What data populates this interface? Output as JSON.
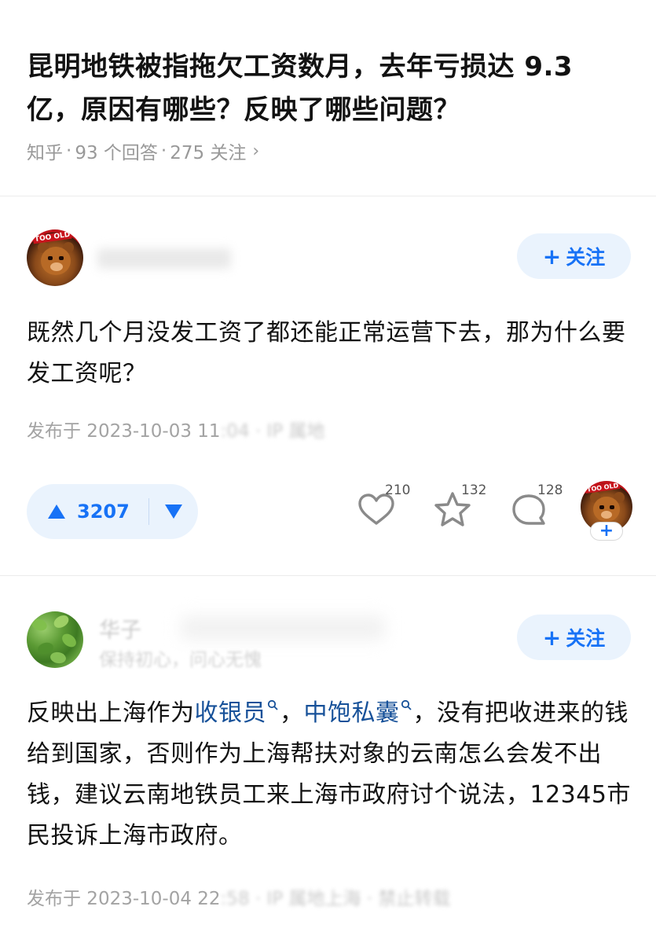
{
  "question": {
    "title": "昆明地铁被指拖欠工资数月，去年亏损达 9.3 亿，原因有哪些？反映了哪些问题？",
    "source": "知乎",
    "answers_count": "93 个回答",
    "followers_count": "275 关注"
  },
  "answers": [
    {
      "author_name": "",
      "follow_label": "关注",
      "text": "既然几个月没发工资了都还能正常运营下去，那为什么要发工资呢？",
      "published_prefix": "发布于 2023-10-03 11",
      "published_masked": ":04 · IP 属地",
      "upvotes": "3207",
      "likes": "210",
      "favorites": "132",
      "comments": "128",
      "colors": {
        "accent": "#1772f6",
        "accent_bg": "#eaf3fd"
      },
      "icons": [
        "upvote-icon",
        "downvote-icon",
        "heart-icon",
        "star-icon",
        "comment-icon"
      ]
    },
    {
      "author_name": "华子",
      "author_bio": "保持初心，问心无愧",
      "follow_label": "关注",
      "text_part1": "反映出上海作为",
      "link1": "收银员",
      "text_part2": "，",
      "link2": "中饱私囊",
      "text_part3": "，没有把收进来的钱给到国家，否则作为上海帮扶对象的云南怎么会发不出钱，建议云南地铁员工来上海市政府讨个说法，12345市民投诉上海市政府。",
      "published_prefix": "发布于 2023-10-04 22",
      "published_masked": ":58 · IP 属地上海 · 禁止转载"
    }
  ]
}
